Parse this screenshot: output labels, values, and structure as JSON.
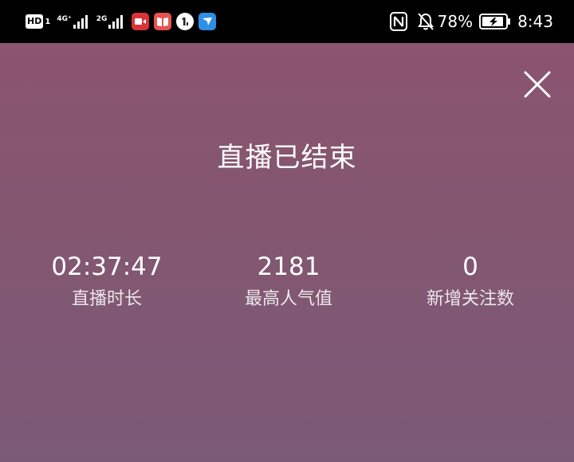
{
  "status_bar": {
    "hd_label": "HD",
    "hd_sim": "1",
    "network_1": "4G⁺",
    "network_2": "2G",
    "battery_percent": "78%",
    "time": "8:43",
    "icons": [
      "hd-icon",
      "signal-4g-icon",
      "signal-2g-icon",
      "video-app-icon",
      "book-app-icon",
      "one-app-icon",
      "bird-app-icon",
      "nfc-icon",
      "bell-off-icon",
      "battery-charging-icon"
    ]
  },
  "colors": {
    "background_top": "#8b5470",
    "background_bottom": "#7b5a78",
    "text": "#ffffff"
  },
  "live_end": {
    "title": "直播已结束",
    "close_icon": "close-icon",
    "stats": [
      {
        "value": "02:37:47",
        "label": "直播时长"
      },
      {
        "value": "2181",
        "label": "最高人气值"
      },
      {
        "value": "0",
        "label": "新增关注数"
      }
    ]
  }
}
